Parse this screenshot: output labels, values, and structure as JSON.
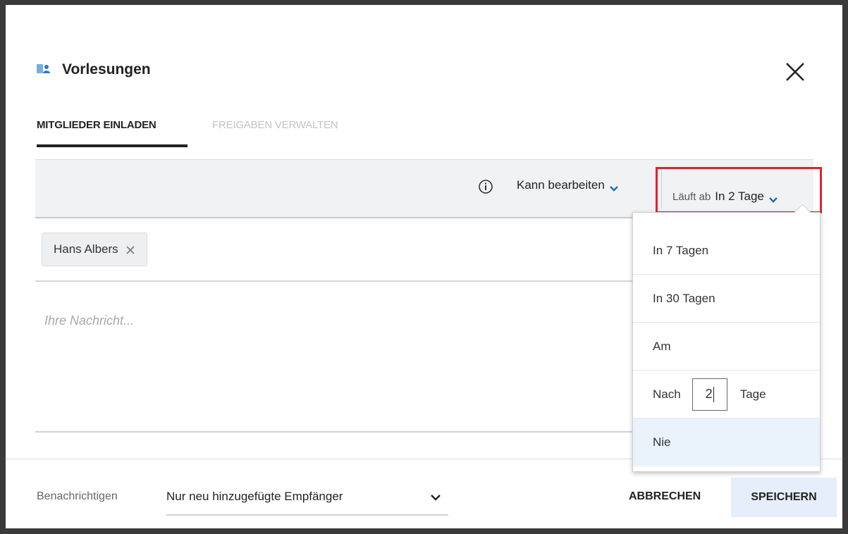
{
  "dialog": {
    "title": "Vorlesungen",
    "icon": "group-folder-icon",
    "close_icon": "close-icon"
  },
  "tabs": [
    {
      "label": "MITGLIEDER EINLADEN",
      "active": true
    },
    {
      "label": "FREIGABEN VERWALTEN",
      "active": false
    }
  ],
  "toolbar": {
    "info_icon": "info-icon",
    "permission_label": "Kann bearbeiten",
    "expiry_prefix": "Läuft ab",
    "expiry_value": "In 2 Tage"
  },
  "recipients": [
    {
      "name": "Hans Albers"
    }
  ],
  "message": {
    "placeholder": "Ihre Nachricht..."
  },
  "expiry_dropdown": {
    "options": [
      {
        "label": "In 7 Tagen"
      },
      {
        "label": "In 30 Tagen"
      },
      {
        "label": "Am"
      },
      {
        "label_before": "Nach",
        "value": "2",
        "label_after": "Tage"
      },
      {
        "label": "Nie",
        "highlighted": true
      }
    ]
  },
  "footer": {
    "notify_label": "Benachrichtigen",
    "notify_value": "Nur neu hinzugefügte Empfänger",
    "cancel_label": "ABBRECHEN",
    "save_label": "SPEICHERN"
  },
  "colors": {
    "accent": "#1a6fb5",
    "highlight_border": "#e3212b",
    "save_bg": "#e5eefa"
  }
}
